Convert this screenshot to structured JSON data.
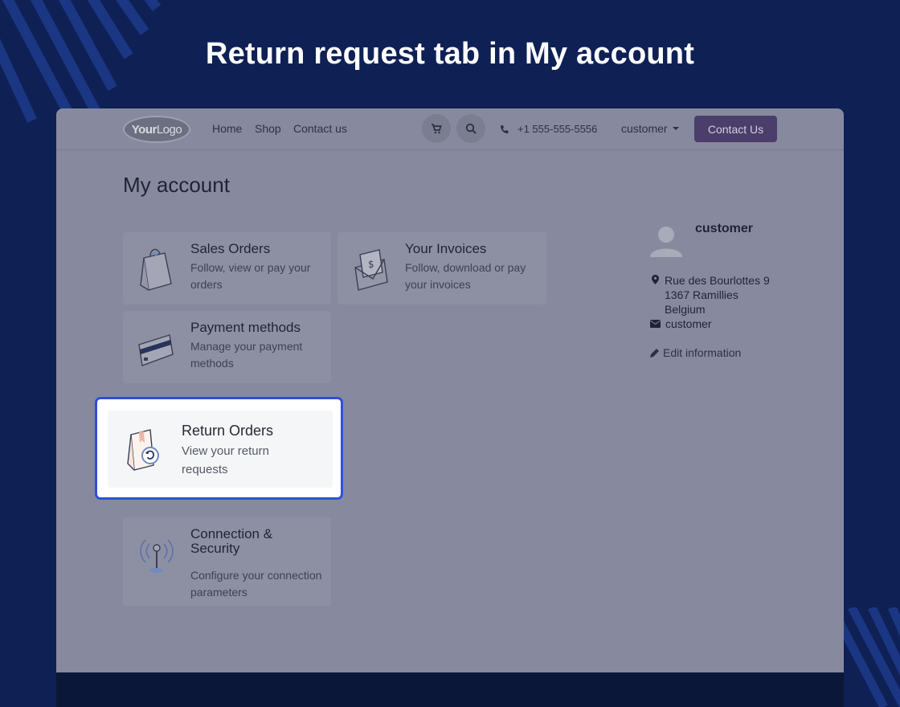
{
  "headline": "Return request tab in My account",
  "navbar": {
    "logo_bold": "Your",
    "logo_thin": "Logo",
    "links": [
      "Home",
      "Shop",
      "Contact us"
    ],
    "phone": "+1 555-555-5556",
    "user": "customer",
    "contact_button": "Contact Us"
  },
  "page_title": "My account",
  "cards": [
    {
      "title": "Sales Orders",
      "description": "Follow, view or pay your orders",
      "icon": "shopping-bag-icon"
    },
    {
      "title": "Your Invoices",
      "description": "Follow, download or pay your invoices",
      "icon": "invoice-envelope-icon"
    },
    {
      "title": "Payment methods",
      "description": "Manage your payment methods",
      "icon": "credit-card-icon"
    },
    {
      "title": "Return Orders",
      "description": "View your return requests",
      "icon": "return-box-icon"
    },
    {
      "title": "Connection & Security",
      "description": "Configure your connection parameters",
      "icon": "antenna-icon"
    }
  ],
  "sidebar": {
    "name": "customer",
    "address_lines": [
      "Rue des Bourlottes 9",
      "1367 Ramillies",
      "Belgium"
    ],
    "email": "customer",
    "edit_label": "Edit information"
  },
  "colors": {
    "background": "#0f2055",
    "highlight_border": "#2f4fd8",
    "contact_button": "#4c3e6b"
  }
}
